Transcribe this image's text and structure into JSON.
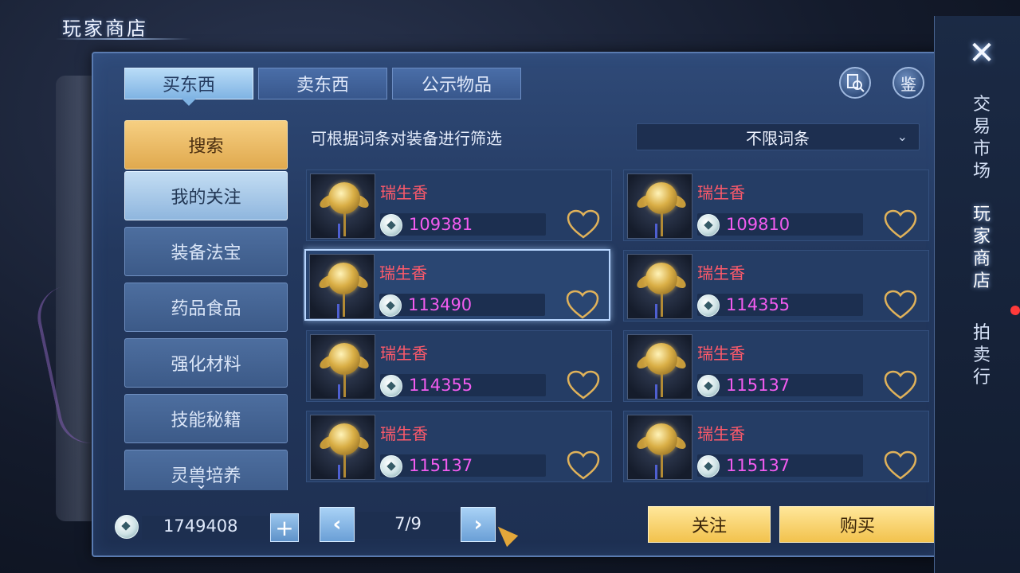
{
  "page_title": "玩家商店",
  "tabs": [
    {
      "label": "买东西",
      "active": true
    },
    {
      "label": "卖东西",
      "active": false
    },
    {
      "label": "公示物品",
      "active": false
    }
  ],
  "header_icons": {
    "inspect": "magnifier-icon",
    "appraise_label": "鉴"
  },
  "categories": [
    {
      "label": "搜索",
      "style": "search"
    },
    {
      "label": "我的关注",
      "style": "selected"
    },
    {
      "label": "装备法宝",
      "style": "normal"
    },
    {
      "label": "药品食品",
      "style": "normal"
    },
    {
      "label": "强化材料",
      "style": "normal"
    },
    {
      "label": "技能秘籍",
      "style": "normal"
    },
    {
      "label": "灵兽培养",
      "style": "normal"
    }
  ],
  "filter": {
    "hint": "可根据词条对装备进行筛选",
    "selected": "不限词条"
  },
  "items": [
    {
      "name": "瑞生香",
      "price": "109381",
      "selected": false
    },
    {
      "name": "瑞生香",
      "price": "109810",
      "selected": false
    },
    {
      "name": "瑞生香",
      "price": "113490",
      "selected": true
    },
    {
      "name": "瑞生香",
      "price": "114355",
      "selected": false
    },
    {
      "name": "瑞生香",
      "price": "114355",
      "selected": false
    },
    {
      "name": "瑞生香",
      "price": "115137",
      "selected": false
    },
    {
      "name": "瑞生香",
      "price": "115137",
      "selected": false
    },
    {
      "name": "瑞生香",
      "price": "115137",
      "selected": false
    }
  ],
  "wallet": {
    "amount": "1749408",
    "plus_label": "+"
  },
  "pagination": {
    "text": "7/9",
    "prev": "‹",
    "next": "›"
  },
  "actions": {
    "follow": "关注",
    "buy": "购买"
  },
  "side_nav": [
    {
      "label": "交易市场",
      "active": false
    },
    {
      "label": "玩家商店",
      "active": true
    },
    {
      "label": "拍卖行",
      "active": false
    }
  ],
  "colors": {
    "item_name": "#ff5a6a",
    "price": "#f25cf0",
    "heart": "#e0b25a",
    "gold_button": "#f2c24d"
  }
}
